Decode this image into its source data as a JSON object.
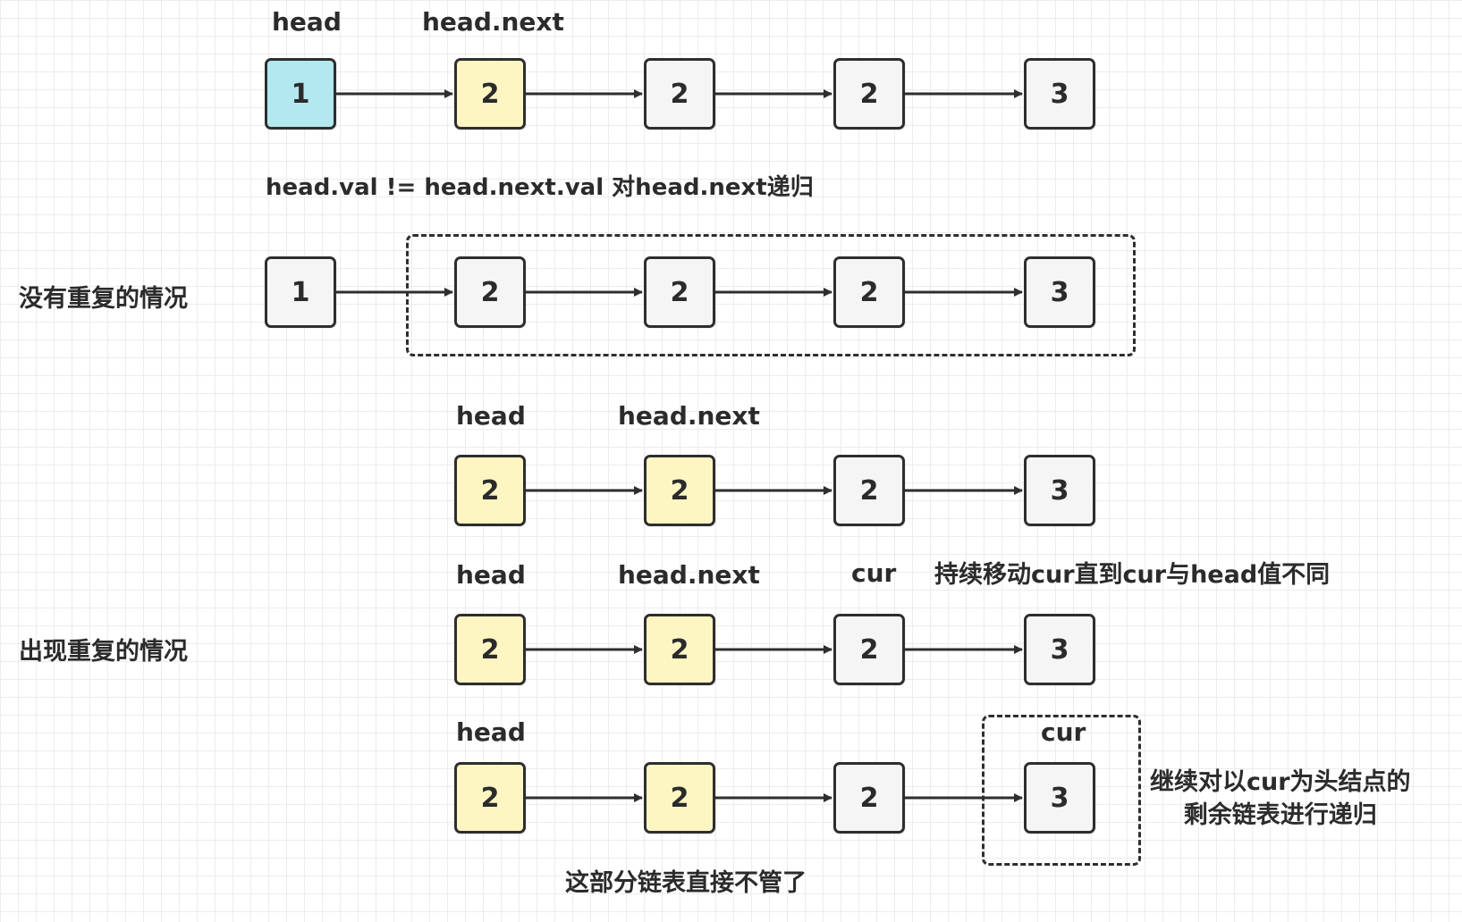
{
  "colors": {
    "node_default": "#f5f5f5",
    "node_cyan": "#b3e8ef",
    "node_yellow": "#fdf6c3",
    "stroke": "#2e2e2e",
    "text": "#2b2b2b"
  },
  "labels": {
    "row1_head": "head",
    "row1_head_next": "head.next",
    "condition_text": "head.val != head.next.val 对head.next递归",
    "case_no_dup": "没有重复的情况",
    "row3_head": "head",
    "row3_head_next": "head.next",
    "row4_head": "head",
    "row4_head_next": "head.next",
    "row4_cur": "cur",
    "row4_move_text": "持续移动cur直到cur与head值不同",
    "case_dup": "出现重复的情况",
    "row5_head": "head",
    "row5_cur": "cur",
    "recurse_line1": "继续对以cur为头结点的",
    "recurse_line2": "剩余链表进行递归",
    "ignore_text": "这部分链表直接不管了"
  },
  "rows": [
    {
      "id": "row1",
      "nodes": [
        {
          "value": "1",
          "fill": "cyan"
        },
        {
          "value": "2",
          "fill": "yellow"
        },
        {
          "value": "2",
          "fill": "default"
        },
        {
          "value": "2",
          "fill": "default"
        },
        {
          "value": "3",
          "fill": "default"
        }
      ]
    },
    {
      "id": "row2",
      "nodes": [
        {
          "value": "1",
          "fill": "default"
        },
        {
          "value": "2",
          "fill": "default"
        },
        {
          "value": "2",
          "fill": "default"
        },
        {
          "value": "2",
          "fill": "default"
        },
        {
          "value": "3",
          "fill": "default"
        }
      ]
    },
    {
      "id": "row3",
      "nodes": [
        {
          "value": "2",
          "fill": "yellow"
        },
        {
          "value": "2",
          "fill": "yellow"
        },
        {
          "value": "2",
          "fill": "default"
        },
        {
          "value": "3",
          "fill": "default"
        }
      ]
    },
    {
      "id": "row4",
      "nodes": [
        {
          "value": "2",
          "fill": "yellow"
        },
        {
          "value": "2",
          "fill": "yellow"
        },
        {
          "value": "2",
          "fill": "default"
        },
        {
          "value": "3",
          "fill": "default"
        }
      ]
    },
    {
      "id": "row5",
      "nodes": [
        {
          "value": "2",
          "fill": "yellow"
        },
        {
          "value": "2",
          "fill": "yellow"
        },
        {
          "value": "2",
          "fill": "default"
        },
        {
          "value": "3",
          "fill": "default"
        }
      ]
    }
  ]
}
